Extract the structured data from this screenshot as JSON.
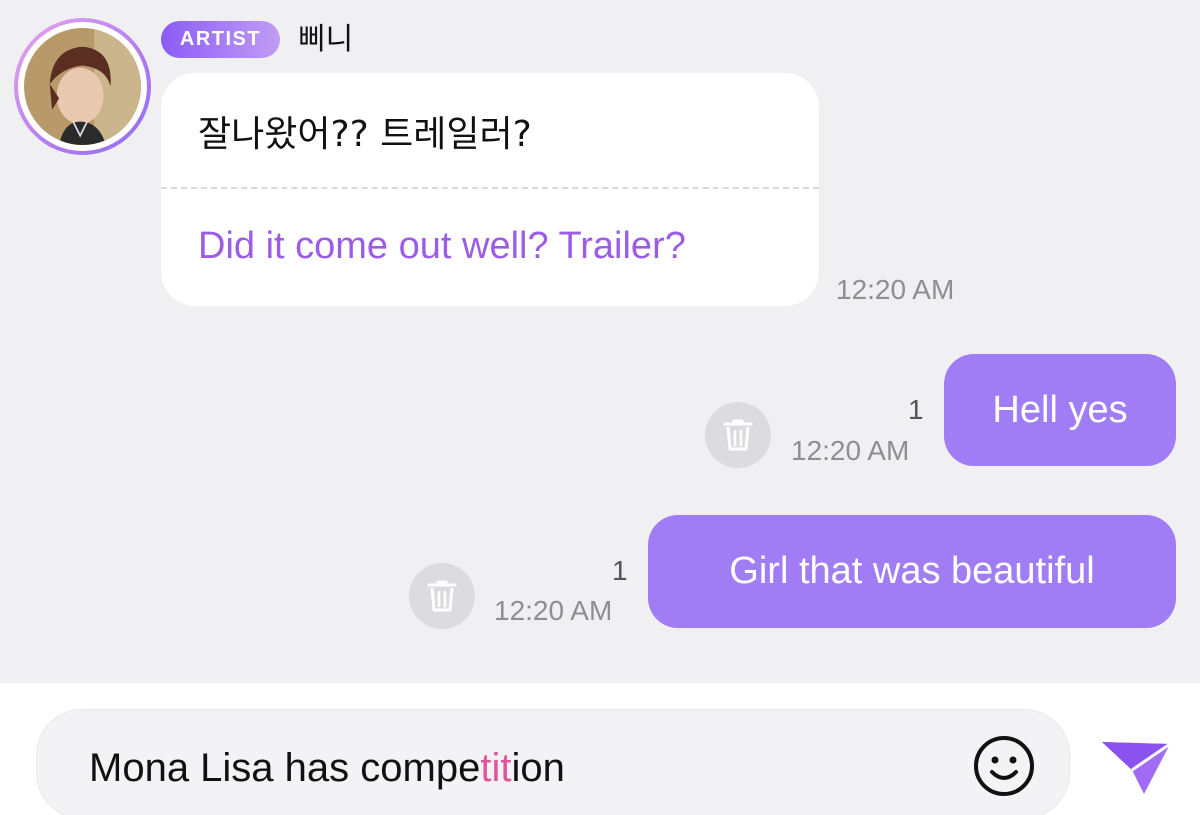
{
  "header": {
    "badge_label": "ARTIST",
    "artist_name": "삐니"
  },
  "messages": [
    {
      "direction": "incoming",
      "original": "잘나왔어?? 트레일러?",
      "translation": "Did it come out well? Trailer?",
      "time": "12:20 AM"
    },
    {
      "direction": "outgoing",
      "text": "Hell yes",
      "read_count": "1",
      "time": "12:20 AM"
    },
    {
      "direction": "outgoing",
      "text": "Girl that was beautiful",
      "read_count": "1",
      "time": "12:20 AM"
    }
  ],
  "composer": {
    "text_before": "Mona Lisa has compe",
    "text_highlight": "tit",
    "text_after": "ion",
    "emoji_icon": "smiley-icon",
    "send_icon": "paper-plane-icon"
  },
  "colors": {
    "accent": "#a07cf5",
    "translation": "#9b5de5",
    "highlight": "#e0569a",
    "background": "#f0f0f2"
  }
}
